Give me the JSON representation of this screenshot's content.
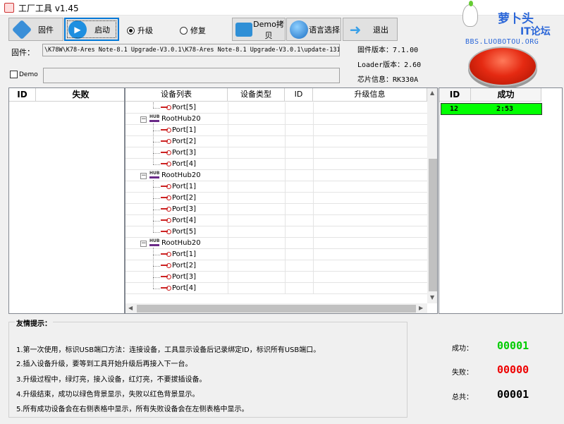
{
  "window": {
    "title": "工厂工具 v1.45"
  },
  "logo": {
    "line1": "萝卜头",
    "line2": "IT论坛",
    "url": "BBS.LUOBOTOU.ORG"
  },
  "toolbar": {
    "firmware_label": "固件",
    "start_label": "启动",
    "upgrade_label": "升级",
    "repair_label": "修复",
    "demo_copy_label": "Demo拷贝",
    "language_label": "语言选择",
    "exit_label": "退出"
  },
  "firmware": {
    "label": "固件：",
    "path": "\\K78W\\K78-Ares Note-8.1 Upgrade-V3.0.1\\K78-Ares Note-8.1 Upgrade-V3.0.1\\update-131.img"
  },
  "info": {
    "firmware_version": "固件版本：7.1.00",
    "loader_version": "Loader版本：2.60",
    "chip_info": "芯片信息：RK330A"
  },
  "demo": {
    "label": "Demo",
    "value": ""
  },
  "fail_table": {
    "col_id": "ID",
    "col_fail": "失败"
  },
  "device_table": {
    "col_device_list": "设备列表",
    "col_device_type": "设备类型",
    "col_id": "ID",
    "col_upgrade_info": "升级信息",
    "rows": [
      {
        "kind": "port",
        "label": "Port[5]"
      },
      {
        "kind": "hub",
        "label": "RootHub20"
      },
      {
        "kind": "port",
        "label": "Port[1]"
      },
      {
        "kind": "port",
        "label": "Port[2]"
      },
      {
        "kind": "port",
        "label": "Port[3]"
      },
      {
        "kind": "port",
        "label": "Port[4]"
      },
      {
        "kind": "hub",
        "label": "RootHub20"
      },
      {
        "kind": "port",
        "label": "Port[1]"
      },
      {
        "kind": "port",
        "label": "Port[2]"
      },
      {
        "kind": "port",
        "label": "Port[3]"
      },
      {
        "kind": "port",
        "label": "Port[4]"
      },
      {
        "kind": "port",
        "label": "Port[5]"
      },
      {
        "kind": "hub",
        "label": "RootHub20"
      },
      {
        "kind": "port",
        "label": "Port[1]"
      },
      {
        "kind": "port",
        "label": "Port[2]"
      },
      {
        "kind": "port",
        "label": "Port[3]"
      },
      {
        "kind": "port",
        "label": "Port[4]"
      }
    ]
  },
  "success_table": {
    "col_id": "ID",
    "col_success": "成功",
    "rows": [
      {
        "id": "12",
        "time": "2:53"
      }
    ]
  },
  "tips": {
    "title": "友情提示：",
    "items": [
      "1.第一次使用，标识USB端口方法：连接设备，工具显示设备后记录绑定ID，标识所有USB端口。",
      "2.插入设备升级，要等到工具开始升级后再接入下一台。",
      "3.升级过程中，绿灯亮，接入设备，红灯亮，不要拔插设备。",
      "4.升级结束，成功以绿色背景显示，失败以红色背景显示。",
      "5.所有成功设备会在右侧表格中显示，所有失败设备会在左侧表格中显示。"
    ]
  },
  "stats": {
    "success_label": "成功：",
    "success_value": "00001",
    "fail_label": "失败：",
    "fail_value": "00000",
    "total_label": "总共：",
    "total_value": "00001"
  },
  "colors": {
    "success": "#00cc00",
    "fail": "#ee0000",
    "success_row": "#00ff00",
    "accent": "#0078d7"
  }
}
